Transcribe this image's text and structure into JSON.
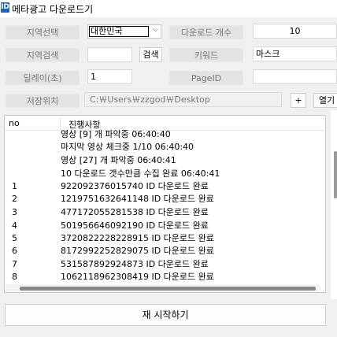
{
  "window": {
    "icon_glyph": "ID",
    "title": "메타광고 다운로드기"
  },
  "form": {
    "region_select_label": "지역선택",
    "region_select_value": "대한민국",
    "download_count_label": "다운로드 개수",
    "download_count_value": "10",
    "region_search_label": "지역검색",
    "region_search_value": "",
    "search_button": "검색",
    "keyword_label": "키워드",
    "keyword_value": "마스크",
    "delay_label": "딜레이(초)",
    "delay_value": "1",
    "pageid_label": "PageID",
    "pageid_value": "",
    "save_location_label": "저장위치",
    "save_location_value": "C:￦Users￦zzgod￦Desktop",
    "add_button": "+",
    "open_button": "열기"
  },
  "log": {
    "columns": {
      "no": "no",
      "progress": "진행사항"
    },
    "rows": [
      {
        "no": "",
        "text": "영상 [9] 개 파악중 06:40:40"
      },
      {
        "no": "",
        "text": "마지막 영상 체크중 1/10 06:40:40"
      },
      {
        "no": "",
        "text": "영상 [27] 개 파악중 06:40:41"
      },
      {
        "no": "",
        "text": "10 다운로드 갯수만큼 수집 완료 06:40:41"
      },
      {
        "no": "1",
        "text": "922092376015740 ID 다운로드 완료"
      },
      {
        "no": "2",
        "text": "1219751632641148 ID 다운로드 완료"
      },
      {
        "no": "3",
        "text": "477172055281538 ID 다운로드 완료"
      },
      {
        "no": "4",
        "text": "501956646092190 ID 다운로드 완료"
      },
      {
        "no": "5",
        "text": "3720822228228915 ID 다운로드 완료"
      },
      {
        "no": "6",
        "text": "8172992252829075 ID 다운로드 완료"
      },
      {
        "no": "7",
        "text": "531587892924873 ID 다운로드 완료"
      },
      {
        "no": "8",
        "text": "1062118962308419 ID 다운로드 완료"
      }
    ]
  },
  "restart_button": "재 시작하기",
  "icons": {
    "app": "app-icon",
    "dropdown": "chevron-down-icon"
  }
}
